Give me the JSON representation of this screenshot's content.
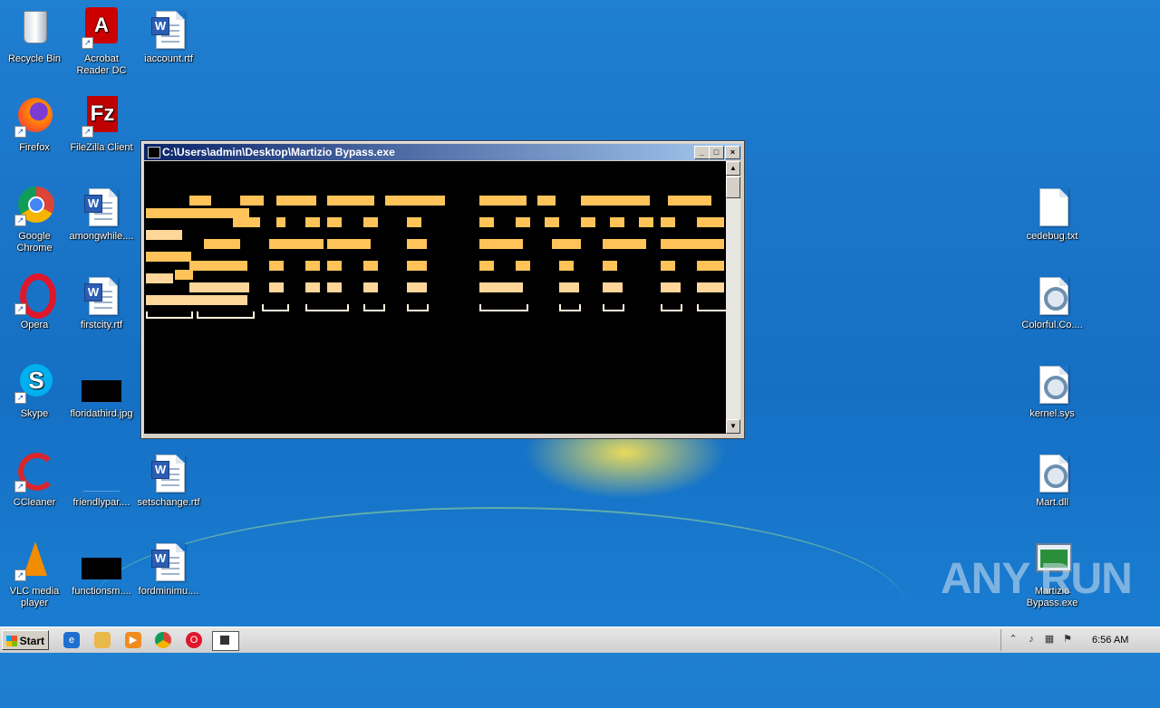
{
  "desktop_icons": [
    {
      "label": "Recycle Bin",
      "icon": "recycle-bin-icon"
    },
    {
      "label": "Acrobat Reader DC",
      "icon": "acrobat-icon"
    },
    {
      "label": "iaccount.rtf",
      "icon": "word-doc-icon"
    },
    {
      "label": "Firefox",
      "icon": "firefox-icon"
    },
    {
      "label": "FileZilla Client",
      "icon": "filezilla-icon"
    },
    {
      "label": "Google Chrome",
      "icon": "chrome-icon"
    },
    {
      "label": "amongwhile....",
      "icon": "word-doc-icon"
    },
    {
      "label": "Opera",
      "icon": "opera-icon"
    },
    {
      "label": "firstcity.rtf",
      "icon": "word-doc-icon"
    },
    {
      "label": "Skype",
      "icon": "skype-icon"
    },
    {
      "label": "floridathird.jpg",
      "icon": "image-file-icon"
    },
    {
      "label": "CCleaner",
      "icon": "ccleaner-icon"
    },
    {
      "label": "friendlypar....",
      "icon": "blank-file-icon"
    },
    {
      "label": "setschange.rtf",
      "icon": "word-doc-icon"
    },
    {
      "label": "VLC media player",
      "icon": "vlc-icon"
    },
    {
      "label": "functionsm....",
      "icon": "image-file-icon"
    },
    {
      "label": "fordminimu....",
      "icon": "word-doc-icon"
    },
    {
      "label": "cedebug.txt",
      "icon": "text-file-icon"
    },
    {
      "label": "Colorful.Co....",
      "icon": "system-file-icon"
    },
    {
      "label": "kernel.sys",
      "icon": "system-file-icon"
    },
    {
      "label": "Mart.dll",
      "icon": "system-file-icon"
    },
    {
      "label": "Martizio Bypass.exe",
      "icon": "exe-file-icon"
    }
  ],
  "console_window": {
    "title": "C:\\Users\\admin\\Desktop\\Martizio Bypass.exe",
    "buttons": {
      "minimize": "_",
      "maximize": "□",
      "close": "×"
    },
    "ascii_color": "#ffc35a"
  },
  "taskbar": {
    "start_label": "Start",
    "quick_launch": [
      "ie-icon",
      "explorer-icon",
      "media-player-icon",
      "chrome-icon",
      "opera-icon",
      "console-task-icon"
    ],
    "clock": "6:56 AM"
  },
  "watermark": "ANY RUN"
}
